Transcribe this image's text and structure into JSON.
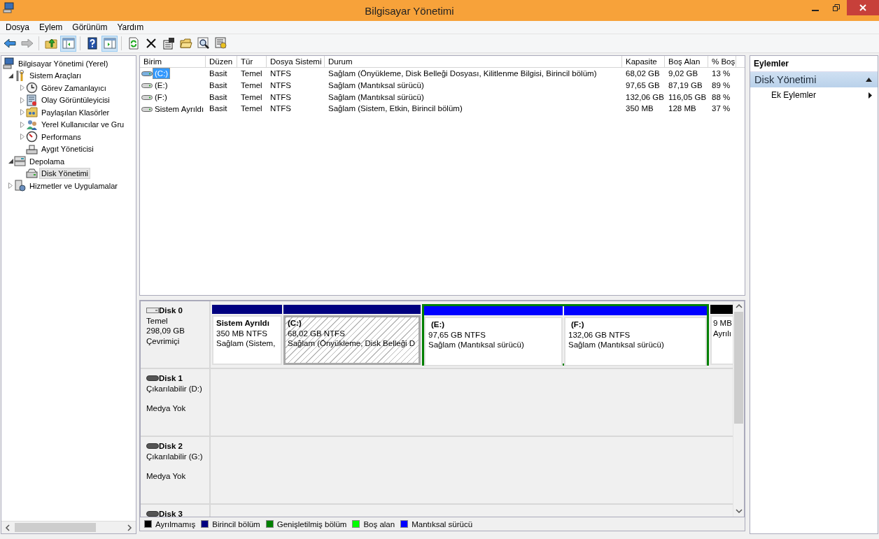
{
  "window": {
    "title": "Bilgisayar Yönetimi"
  },
  "menu": [
    "Dosya",
    "Eylem",
    "Görünüm",
    "Yardım"
  ],
  "toolbar": [
    {
      "pressed": false,
      "disabled": false
    },
    {
      "pressed": false,
      "disabled": true
    },
    {
      "pressed": false,
      "disabled": false
    },
    {
      "pressed": true,
      "disabled": false
    },
    {
      "pressed": false,
      "disabled": false
    },
    {
      "pressed": true,
      "disabled": false
    },
    {
      "pressed": false,
      "disabled": false
    },
    {
      "pressed": false,
      "disabled": false
    },
    {
      "pressed": false,
      "disabled": false
    },
    {
      "pressed": false,
      "disabled": false
    },
    {
      "pressed": false,
      "disabled": false
    },
    {
      "pressed": false,
      "disabled": false
    }
  ],
  "tree": {
    "items": [
      {
        "label": "Bilgisayar Yönetimi (Yerel)",
        "selected": false,
        "children": [
          {
            "label": "Sistem Araçları",
            "expanded": true,
            "selected": false,
            "children": [
              {
                "label": "Görev Zamanlayıcı",
                "expanded": false,
                "selected": false
              },
              {
                "label": "Olay Görüntüleyicisi",
                "expanded": false,
                "selected": false
              },
              {
                "label": "Paylaşılan Klasörler",
                "expanded": false,
                "selected": false
              },
              {
                "label": "Yerel Kullanıcılar ve Gru",
                "expanded": false,
                "selected": false
              },
              {
                "label": "Performans",
                "expanded": false,
                "selected": false
              },
              {
                "label": "Aygıt Yöneticisi",
                "selected": false
              }
            ]
          },
          {
            "label": "Depolama",
            "expanded": true,
            "selected": false,
            "children": [
              {
                "label": "Disk Yönetimi",
                "selected": true
              }
            ]
          },
          {
            "label": "Hizmetler ve Uygulamalar",
            "expanded": false,
            "selected": false
          }
        ]
      }
    ]
  },
  "volumes": {
    "columns": [
      "Birim",
      "Düzen",
      "Tür",
      "Dosya Sistemi",
      "Durum",
      "Kapasite",
      "Boş Alan",
      "% Boş"
    ],
    "rows": [
      {
        "selected": true,
        "cells": [
          "(C:)",
          "Basit",
          "Temel",
          "NTFS",
          "Sağlam (Önyükleme, Disk Belleği Dosyası, Kilitlenme Bilgisi, Birincil bölüm)",
          "68,02 GB",
          "9,02 GB",
          "13 %"
        ]
      },
      {
        "selected": false,
        "cells": [
          "(E:)",
          "Basit",
          "Temel",
          "NTFS",
          "Sağlam (Mantıksal sürücü)",
          "97,65 GB",
          "87,19 GB",
          "89 %"
        ]
      },
      {
        "selected": false,
        "cells": [
          "(F:)",
          "Basit",
          "Temel",
          "NTFS",
          "Sağlam (Mantıksal sürücü)",
          "132,06 GB",
          "116,05 GB",
          "88 %"
        ]
      },
      {
        "selected": false,
        "cells": [
          "Sistem Ayrıldı",
          "Basit",
          "Temel",
          "NTFS",
          "Sağlam (Sistem, Etkin, Birincil bölüm)",
          "350 MB",
          "128 MB",
          "37 %"
        ]
      }
    ]
  },
  "disk_map": {
    "disks": [
      {
        "name": "Disk 0",
        "kind": "basic",
        "lines": [
          "Temel",
          "298,09 GB",
          "Çevrimiçi"
        ],
        "partitions": [
          {
            "kind": "primary",
            "color": "#000080",
            "label": "Sistem Ayrıldı",
            "size": "350 MB NTFS",
            "status": "Sağlam (Sistem,",
            "selected": false
          },
          {
            "kind": "primary",
            "color": "#000080",
            "label": "(C:)",
            "size": "68,02 GB NTFS",
            "status": "Sağlam (Önyükleme, Disk Belleği D",
            "selected": true
          },
          {
            "kind": "extended",
            "color": "#008000",
            "children": [
              {
                "kind": "logical",
                "color": "#0000ff",
                "label": "(E:)",
                "size": "97,65 GB NTFS",
                "status": "Sağlam (Mantıksal sürücü)",
                "selected": false
              },
              {
                "kind": "logical",
                "color": "#0000ff",
                "label": "(F:)",
                "size": "132,06 GB NTFS",
                "status": "Sağlam (Mantıksal sürücü)",
                "selected": false
              }
            ]
          },
          {
            "kind": "unallocated",
            "color": "#000000",
            "size": "9 MB",
            "status": "Ayrılı",
            "selected": false
          }
        ]
      },
      {
        "name": "Disk 1",
        "kind": "removable",
        "lines": [
          "Çıkarılabilir (D:)",
          "Medya Yok"
        ]
      },
      {
        "name": "Disk 2",
        "kind": "removable",
        "lines": [
          "Çıkarılabilir (G:)",
          "Medya Yok"
        ]
      },
      {
        "name": "Disk 3",
        "kind": "removable"
      }
    ]
  },
  "legend": [
    {
      "label": "Ayrılmamış",
      "color": "#000000"
    },
    {
      "label": "Birincil bölüm",
      "color": "#000080"
    },
    {
      "label": "Genişletilmiş bölüm",
      "color": "#008000"
    },
    {
      "label": "Boş alan",
      "color": "#00ff00"
    },
    {
      "label": "Mantıksal sürücü",
      "color": "#0000ff"
    }
  ],
  "actions": {
    "title": "Eylemler",
    "sections": [
      {
        "label": "Disk Yönetimi",
        "expanded": true,
        "items": [
          {
            "label": "Ek Eylemler",
            "submenu": true
          }
        ]
      }
    ]
  }
}
